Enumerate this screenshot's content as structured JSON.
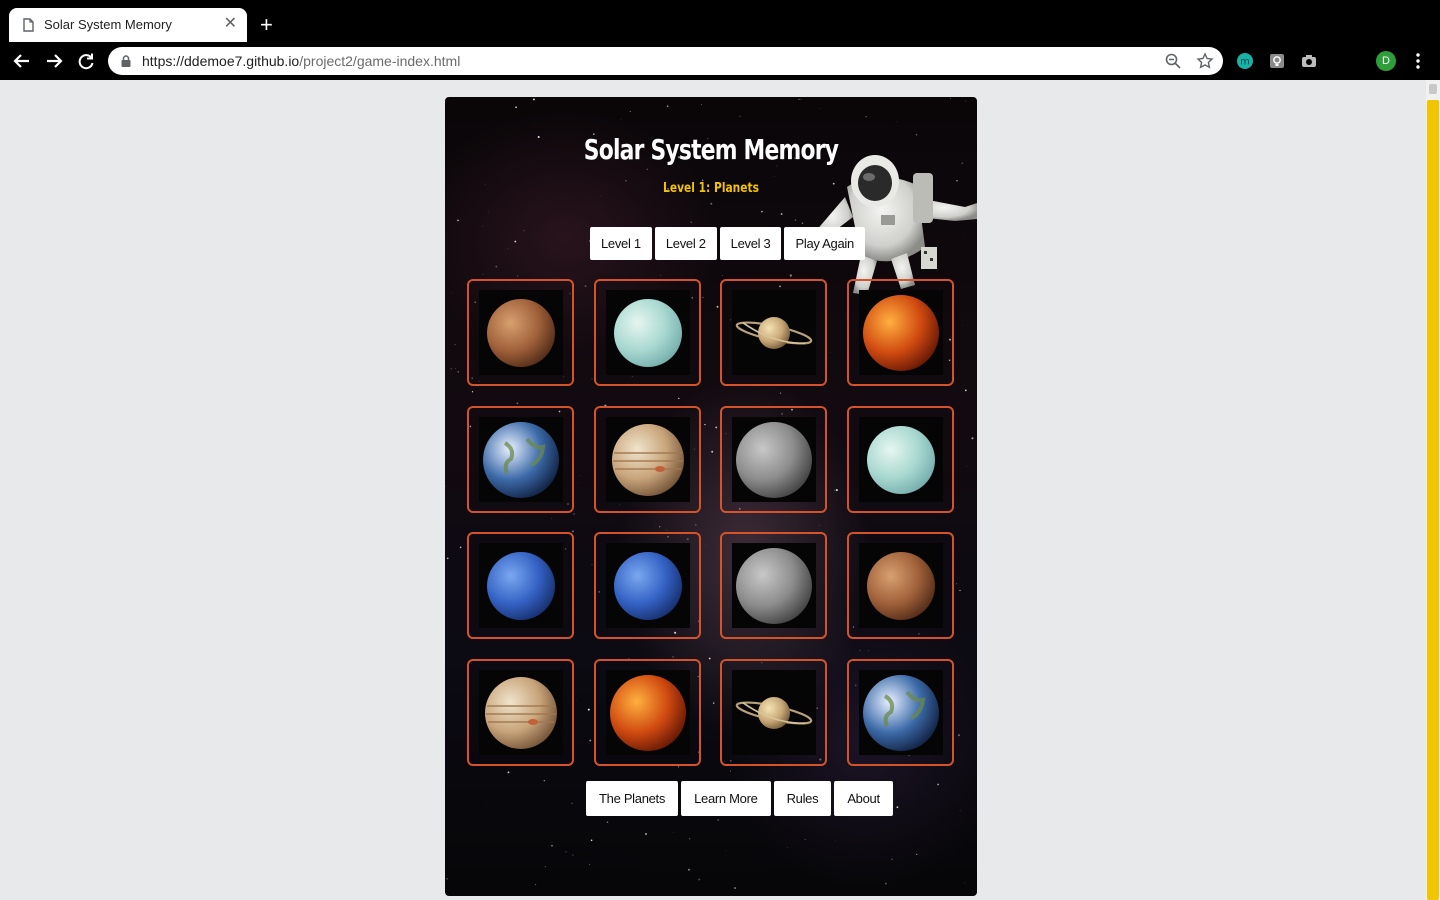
{
  "browser": {
    "tab_title": "Solar System Memory",
    "url_host": "https://ddemoe7.github.io",
    "url_path": "/project2/game-index.html",
    "profile_initial": "D"
  },
  "game": {
    "title": "Solar System Memory",
    "subtitle": "Level 1: Planets",
    "level_buttons": [
      "Level 1",
      "Level 2",
      "Level 3",
      "Play Again"
    ],
    "footer_buttons": [
      "The Planets",
      "Learn More",
      "Rules",
      "About"
    ],
    "cards": [
      [
        "mars",
        "uranus",
        "saturn",
        "venus"
      ],
      [
        "earth",
        "jupiter",
        "mercury",
        "uranus"
      ],
      [
        "neptune",
        "neptune",
        "mercury",
        "mars"
      ],
      [
        "jupiter",
        "venus",
        "saturn",
        "earth"
      ]
    ]
  },
  "colors": {
    "card_border": "#d4532a",
    "subtitle": "#f2c300",
    "scrollbar_thumb": "#f2c500"
  }
}
